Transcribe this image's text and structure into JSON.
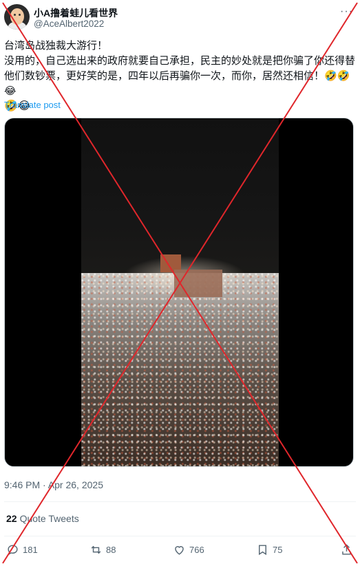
{
  "author": {
    "name": "小A撸着蛙儿看世界",
    "handle": "@AceAlbert2022"
  },
  "post": {
    "lines": [
      "台湾岛战独裁大游行！",
      "没用的，自己选出来的政府就要自己承担，民主的妙处就是把你骗了你还得替",
      "他们数钞票，更好笑的是，四年以后再骗你一次，而你，居然还相信！🤣🤣😂",
      "🤣😂"
    ],
    "translate_label": "Translate post",
    "timestamp": "9:46 PM · Apr 26, 2025"
  },
  "quote_tweets": {
    "count": "22",
    "label": "Quote Tweets"
  },
  "actions": {
    "replies": "181",
    "reposts": "88",
    "likes": "766",
    "bookmarks": "75"
  },
  "icons": [
    "more-icon",
    "reply-icon",
    "repost-icon",
    "like-icon",
    "bookmark-icon",
    "share-icon"
  ],
  "colors": {
    "link": "#1d9bf0",
    "secondary_text": "#536471",
    "overlay_x": "#e0262b"
  }
}
